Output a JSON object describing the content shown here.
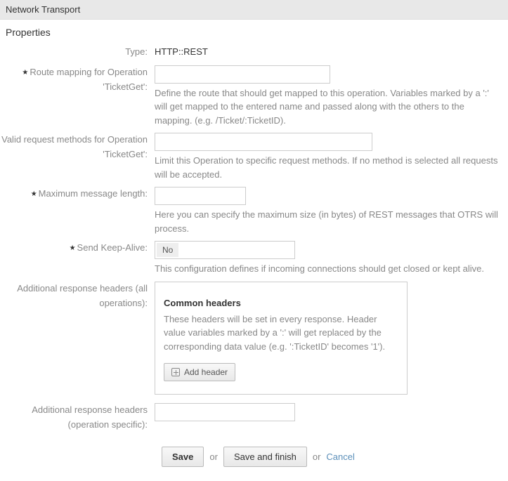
{
  "header": {
    "title": "Network Transport"
  },
  "section": {
    "title": "Properties"
  },
  "fields": {
    "type": {
      "label": "Type:",
      "value": "HTTP::REST"
    },
    "route": {
      "label": "Route mapping for Operation 'TicketGet':",
      "help": "Define the route that should get mapped to this operation. Variables marked by a ':' will get mapped to the entered name and passed along with the others to the mapping. (e.g. /Ticket/:TicketID)."
    },
    "methods": {
      "label": "Valid request methods for Operation 'TicketGet':",
      "help": "Limit this Operation to specific request methods. If no method is selected all requests will be accepted."
    },
    "maxlen": {
      "label": "Maximum message length:",
      "help": "Here you can specify the maximum size (in bytes) of REST messages that OTRS will process."
    },
    "keepalive": {
      "label": "Send Keep-Alive:",
      "value": "No",
      "help": "This configuration defines if incoming connections should get closed or kept alive."
    },
    "headers_all": {
      "label": "Additional response headers (all operations):",
      "box_title": "Common headers",
      "box_desc": "These headers will be set in every response. Header value variables marked by a ':' will get replaced by the corresponding data value (e.g. ':TicketID' becomes '1').",
      "add_btn": "Add header"
    },
    "headers_op": {
      "label": "Additional response headers (operation specific):"
    }
  },
  "actions": {
    "save": "Save",
    "or1": "or",
    "save_finish": "Save and finish",
    "or2": "or",
    "cancel": "Cancel"
  }
}
